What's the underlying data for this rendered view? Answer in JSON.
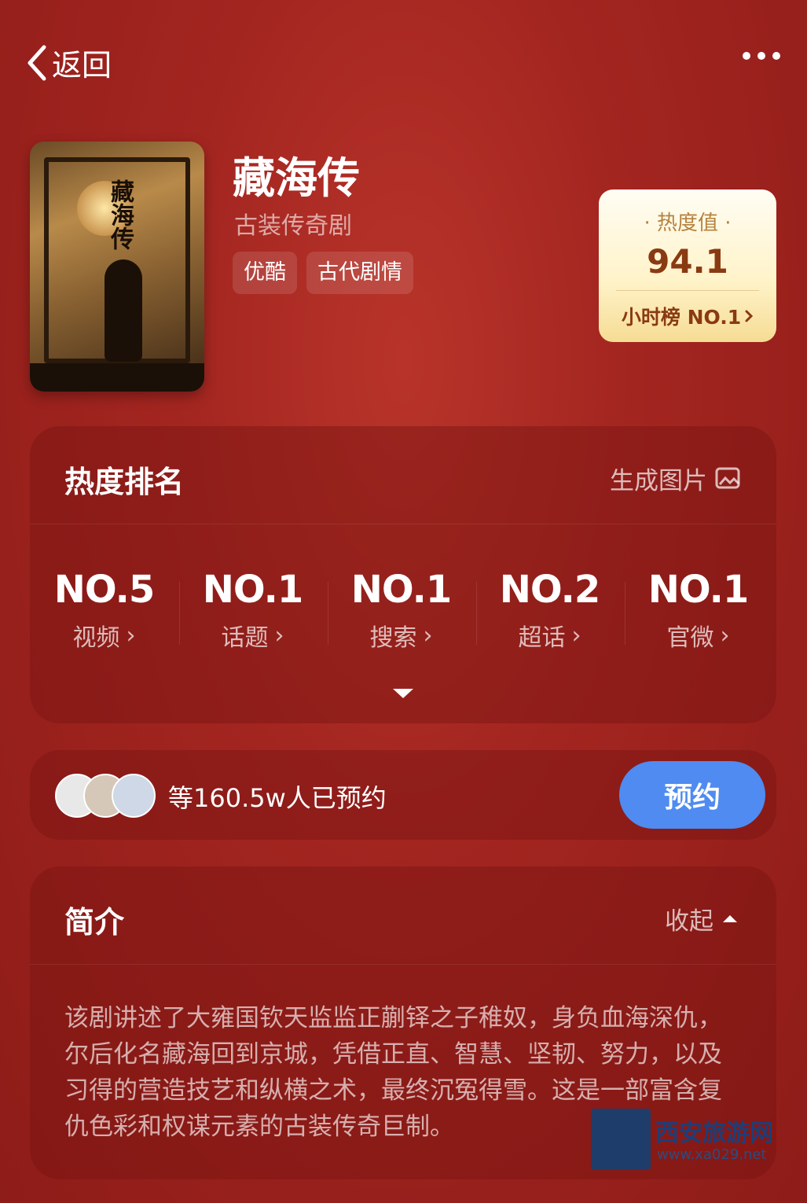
{
  "nav": {
    "back_label": "返回",
    "more_icon": "more-icon"
  },
  "show": {
    "title": "藏海传",
    "genre": "古装传奇剧",
    "tags": [
      "优酷",
      "古代剧情"
    ],
    "poster_title": "藏海传"
  },
  "heat": {
    "label": "· 热度值 ·",
    "value": "94.1",
    "rank_text": "小时榜 NO.1"
  },
  "ranking": {
    "title": "热度排名",
    "generate_image": "生成图片",
    "items": [
      {
        "rank": "NO.5",
        "label": "视频"
      },
      {
        "rank": "NO.1",
        "label": "话题"
      },
      {
        "rank": "NO.1",
        "label": "搜索"
      },
      {
        "rank": "NO.2",
        "label": "超话"
      },
      {
        "rank": "NO.1",
        "label": "官微"
      }
    ]
  },
  "reserve": {
    "count_text": "等160.5w人已预约",
    "button_label": "预约"
  },
  "intro": {
    "title": "简介",
    "collapse_label": "收起",
    "text": "该剧讲述了大雍国钦天监监正蒯铎之子稚奴，身负血海深仇，尔后化名藏海回到京城，凭借正直、智慧、坚韧、努力，以及习得的营造技艺和纵横之术，最终沉冤得雪。这是一部富含复仇色彩和权谋元素的古装传奇巨制。"
  },
  "watermark": {
    "title": "西安旅游网",
    "url": "www.xa029.net"
  },
  "colors": {
    "background": "#a32520",
    "reserve_button": "#4f8bf0",
    "heat_card": "#fff3c9"
  }
}
